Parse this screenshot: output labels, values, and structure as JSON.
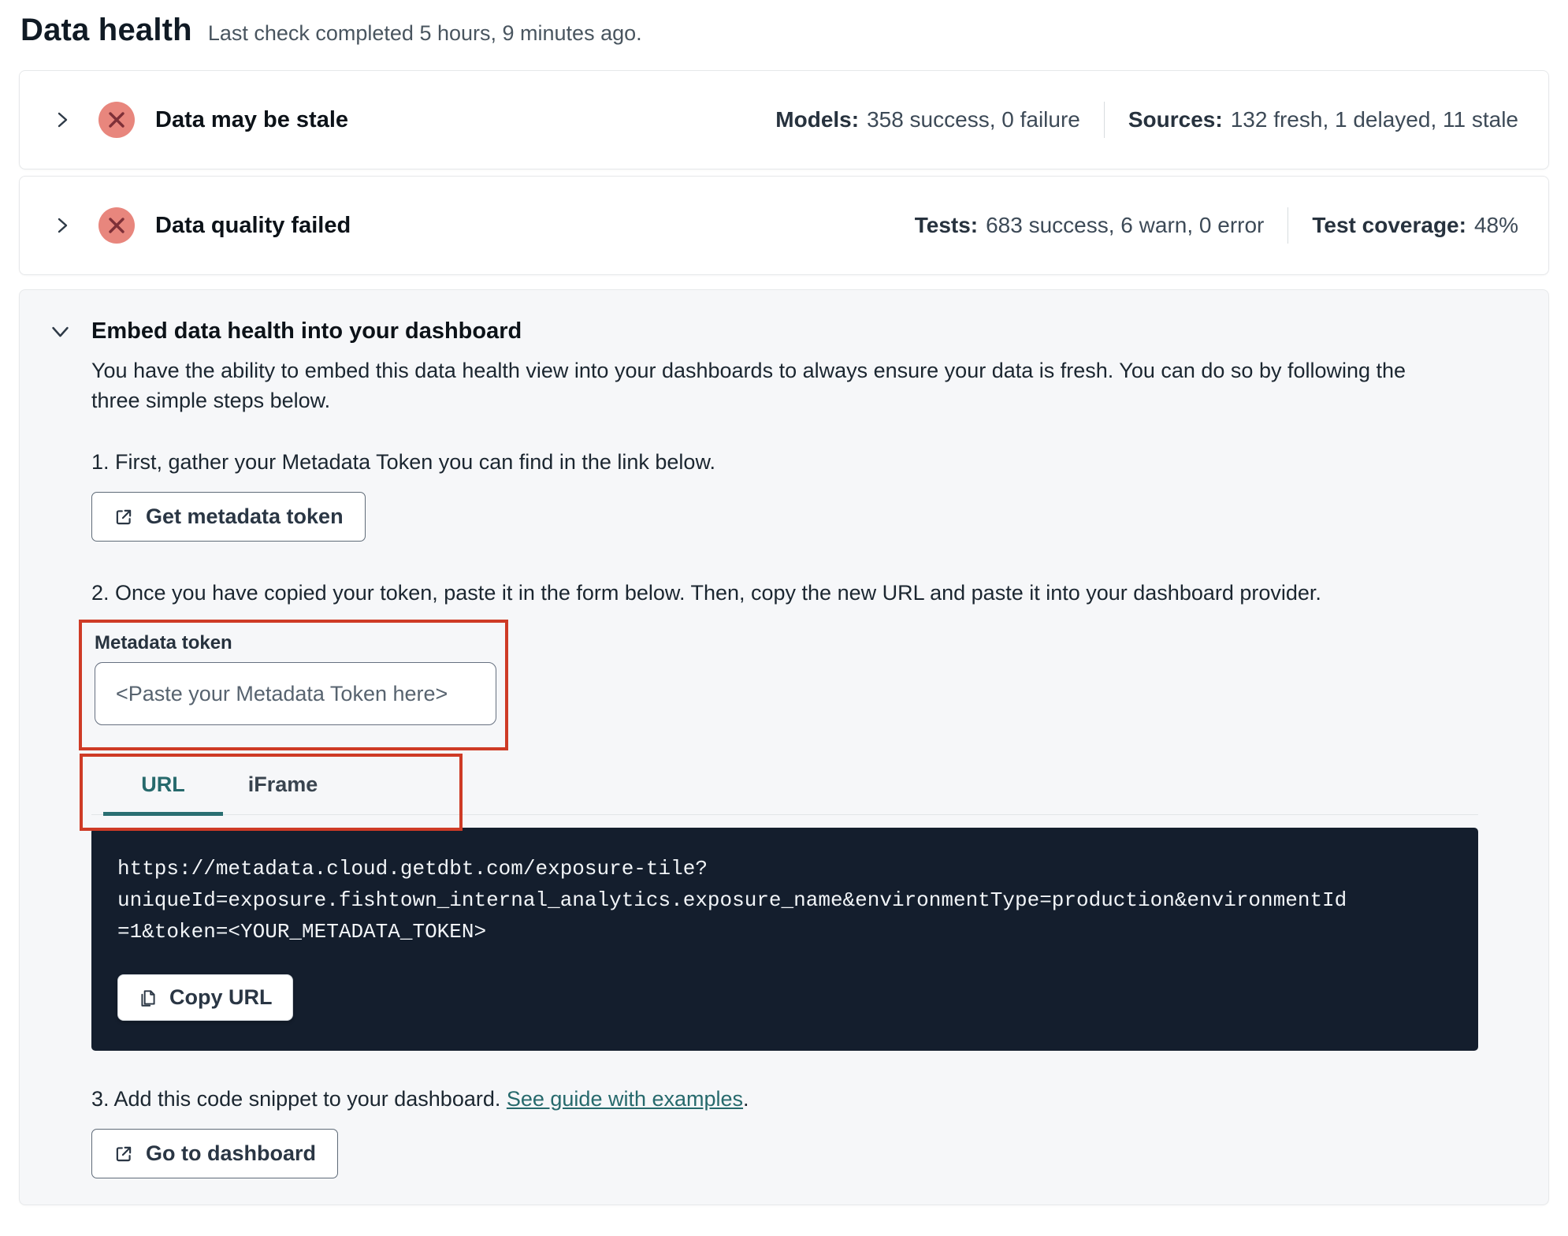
{
  "page": {
    "title": "Data health",
    "subtitle": "Last check completed 5 hours, 9 minutes ago."
  },
  "panels": [
    {
      "title": "Data may be stale",
      "status": "error",
      "stats": [
        {
          "label": "Models:",
          "value": "358 success, 0 failure"
        },
        {
          "label": "Sources:",
          "value": "132 fresh, 1 delayed, 11 stale"
        }
      ]
    },
    {
      "title": "Data quality failed",
      "status": "error",
      "stats": [
        {
          "label": "Tests:",
          "value": "683 success, 6 warn, 0 error"
        },
        {
          "label": "Test coverage:",
          "value": "48%"
        }
      ]
    }
  ],
  "embed": {
    "title": "Embed data health into your dashboard",
    "description": "You have the ability to embed this data health view into your dashboards to always ensure your data is fresh. You can do so by following the three simple steps below.",
    "step1": {
      "text": "1. First, gather your Metadata Token you can find in the link below.",
      "button_label": "Get metadata token"
    },
    "step2": {
      "text": "2. Once you have copied your token, paste it in the form below. Then, copy the new URL and paste it into your dashboard provider.",
      "field_label": "Metadata token",
      "placeholder": "<Paste your Metadata Token here>",
      "tabs": [
        {
          "label": "URL",
          "active": true
        },
        {
          "label": "iFrame",
          "active": false
        }
      ],
      "code_url": "https://metadata.cloud.getdbt.com/exposure-tile?uniqueId=exposure.fishtown_internal_analytics.exposure_name&environmentType=production&environmentId=1&token=<YOUR_METADATA_TOKEN>",
      "code_lines": [
        "https://metadata.cloud.getdbt.com/exposure-tile?",
        "uniqueId=exposure.fishtown_internal_analytics.exposure_name&environmentType=production&environmentId",
        "=1&token=<YOUR_METADATA_TOKEN>"
      ],
      "copy_button_label": "Copy URL"
    },
    "step3": {
      "text_before": "3. Add this code snippet to your dashboard. ",
      "link_label": "See guide with examples",
      "text_after": ".",
      "button_label": "Go to dashboard"
    }
  },
  "colors": {
    "accent_teal": "#26696c",
    "error_circle_bg": "#e8867d",
    "error_circle_x": "#7e3038",
    "annotation_red": "#ce3b26",
    "code_background": "#141e2d",
    "embed_background": "#f6f7f9"
  }
}
